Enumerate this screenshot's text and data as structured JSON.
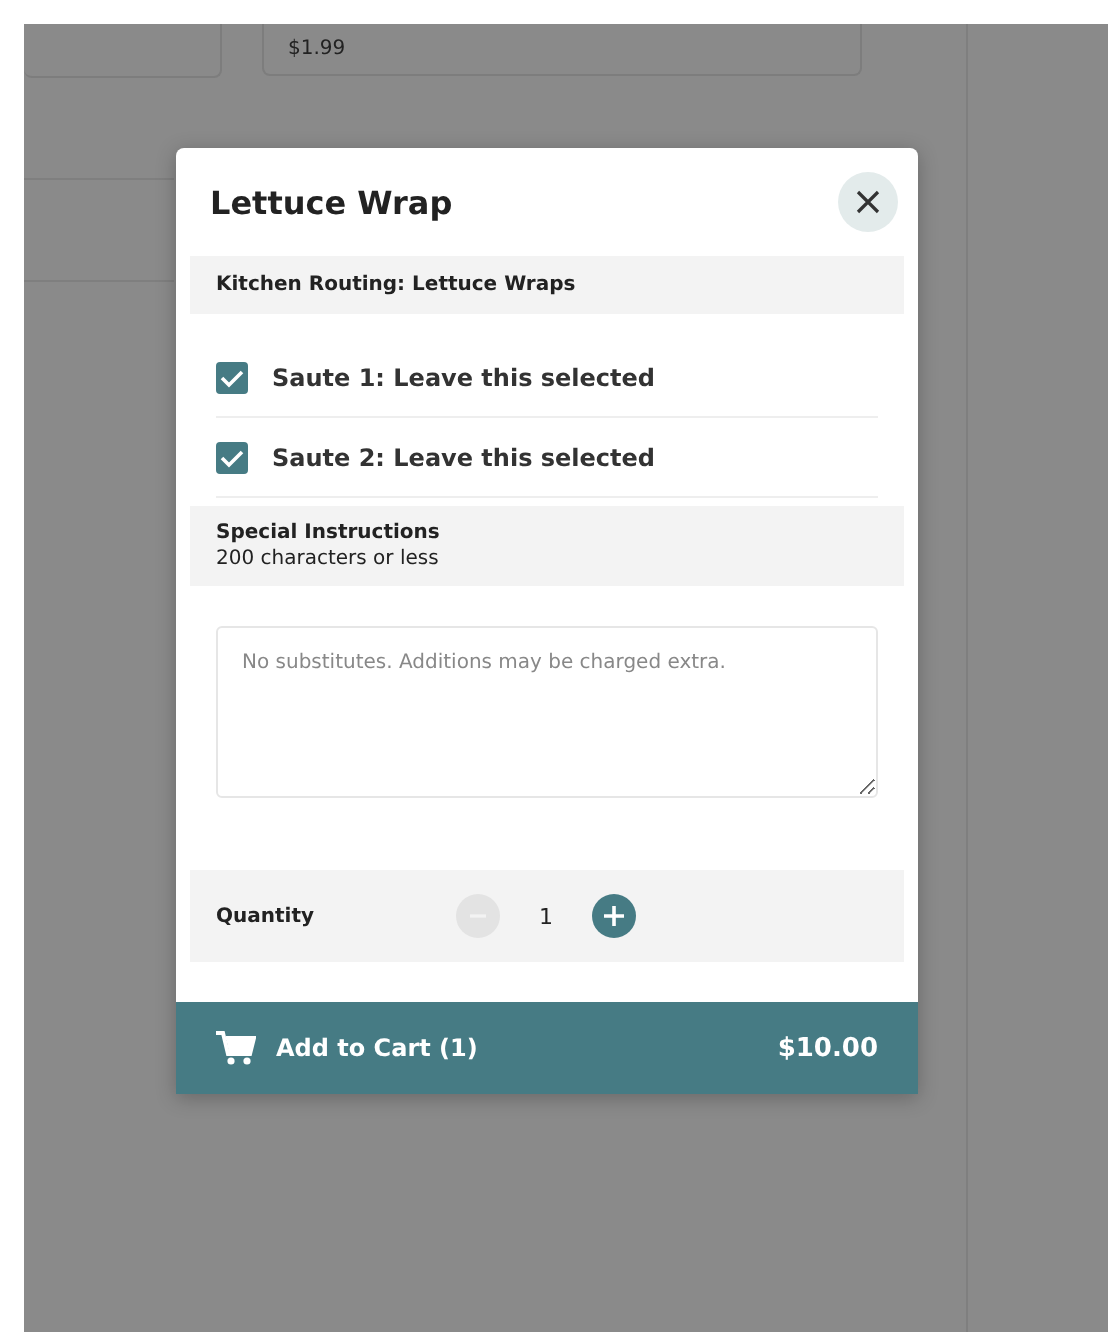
{
  "background": {
    "price": "$1.99"
  },
  "modal": {
    "title": "Lettuce Wrap",
    "routing": {
      "label": "Kitchen Routing: Lettuce Wraps"
    },
    "options": [
      {
        "label": "Saute 1: Leave this selected",
        "checked": true
      },
      {
        "label": "Saute 2: Leave this selected",
        "checked": true
      }
    ],
    "instructions": {
      "title": "Special Instructions",
      "hint": "200 characters or less",
      "placeholder": "No substitutes. Additions may be charged extra."
    },
    "quantity": {
      "label": "Quantity",
      "value": "1",
      "decrement_disabled": true,
      "increment_disabled": false
    },
    "footer": {
      "button": "Add to Cart (1)",
      "total": "$10.00"
    }
  }
}
